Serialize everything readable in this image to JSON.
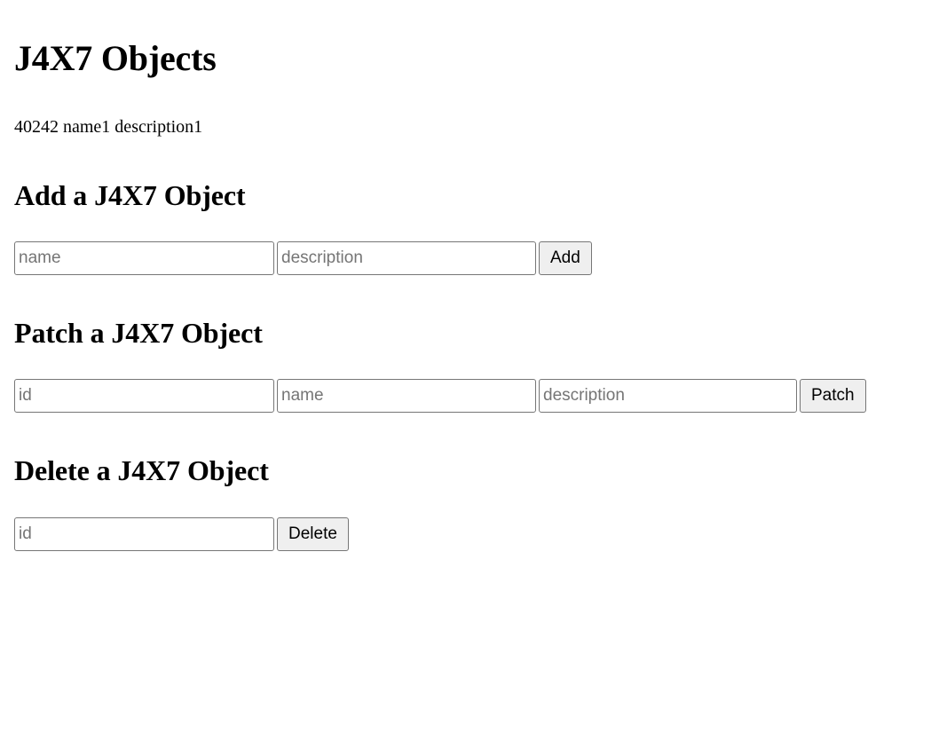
{
  "page": {
    "title": "J4X7 Objects"
  },
  "objects": {
    "rows": [
      {
        "id": "40242",
        "name": "name1",
        "description": "description1",
        "text": "40242 name1 description1"
      }
    ]
  },
  "add_section": {
    "heading": "Add a J4X7 Object",
    "name_placeholder": "name",
    "name_value": "",
    "description_placeholder": "description",
    "description_value": "",
    "submit_label": "Add"
  },
  "patch_section": {
    "heading": "Patch a J4X7 Object",
    "id_placeholder": "id",
    "id_value": "",
    "name_placeholder": "name",
    "name_value": "",
    "description_placeholder": "description",
    "description_value": "",
    "submit_label": "Patch"
  },
  "delete_section": {
    "heading": "Delete a J4X7 Object",
    "id_placeholder": "id",
    "id_value": "",
    "submit_label": "Delete"
  },
  "colors": {
    "page_background": "#ffffff",
    "text": "#000000",
    "input_border": "#767676",
    "placeholder_text": "#757575",
    "button_background": "#efefef"
  }
}
